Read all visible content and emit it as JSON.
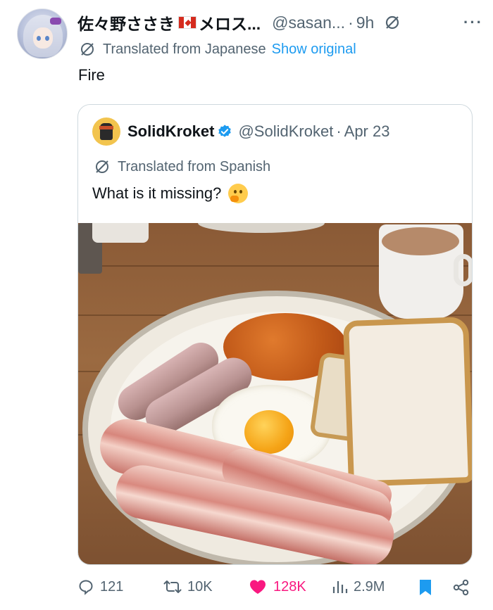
{
  "author": {
    "display_name": "佐々野ささき",
    "display_name_suffix": "メロス...",
    "handle": "@sasan...",
    "separator": "·",
    "time": "9h"
  },
  "translation": {
    "label": "Translated from Japanese",
    "show_original": "Show original"
  },
  "tweet": {
    "text": "Fire"
  },
  "quote": {
    "display_name": "SolidKroket",
    "handle": "@SolidKroket",
    "separator": "·",
    "date": "Apr 23",
    "translation_label": "Translated from Spanish",
    "text": "What is it missing?",
    "emoji": "thinking-face"
  },
  "actions": {
    "replies": "121",
    "retweets": "10K",
    "likes": "128K",
    "views": "2.9M"
  },
  "colors": {
    "link": "#1d9bf0",
    "muted": "#536471",
    "like": "#f91880",
    "verified": "#1d9bf0"
  },
  "icons": [
    "grok-icon",
    "more-icon",
    "translate-icon",
    "verified-icon",
    "reply-icon",
    "retweet-icon",
    "like-icon",
    "views-icon",
    "bookmark-icon",
    "share-icon"
  ]
}
